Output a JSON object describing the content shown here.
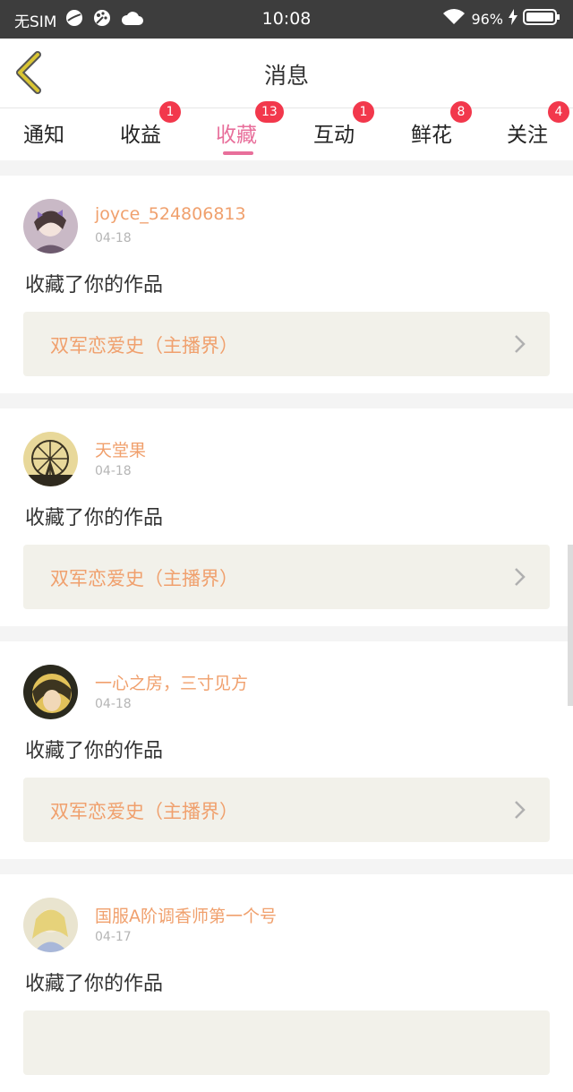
{
  "status_bar": {
    "carrier": "无SIM",
    "time": "10:08",
    "battery": "96%",
    "icons": [
      "browser-icon",
      "palette-icon",
      "cloud-icon",
      "wifi-icon",
      "charging-icon",
      "battery-icon"
    ]
  },
  "header": {
    "title": "消息",
    "back_icon": "chevron-left-icon"
  },
  "tabs": [
    {
      "label": "通知",
      "badge": ""
    },
    {
      "label": "收益",
      "badge": "1"
    },
    {
      "label": "收藏",
      "badge": "13",
      "active": true
    },
    {
      "label": "互动",
      "badge": "1"
    },
    {
      "label": "鲜花",
      "badge": "8"
    },
    {
      "label": "关注",
      "badge": "4"
    }
  ],
  "messages": [
    {
      "user": "joyce_524806813",
      "date": "04-18",
      "action": "收藏了你的作品",
      "work": "双军恋爱史（主播界）"
    },
    {
      "user": "天堂果",
      "date": "04-18",
      "action": "收藏了你的作品",
      "work": "双军恋爱史（主播界）"
    },
    {
      "user": "一心之房，三寸见方",
      "date": "04-18",
      "action": "收藏了你的作品",
      "work": "双军恋爱史（主播界）"
    },
    {
      "user": "国服A阶调香师第一个号",
      "date": "04-17",
      "action": "收藏了你的作品",
      "work": ""
    }
  ],
  "colors": {
    "accent_pink": "#e86f9b",
    "badge_red": "#f2384c",
    "name_orange": "#f0a06d",
    "back_icon_yellow": "#d9c533"
  }
}
